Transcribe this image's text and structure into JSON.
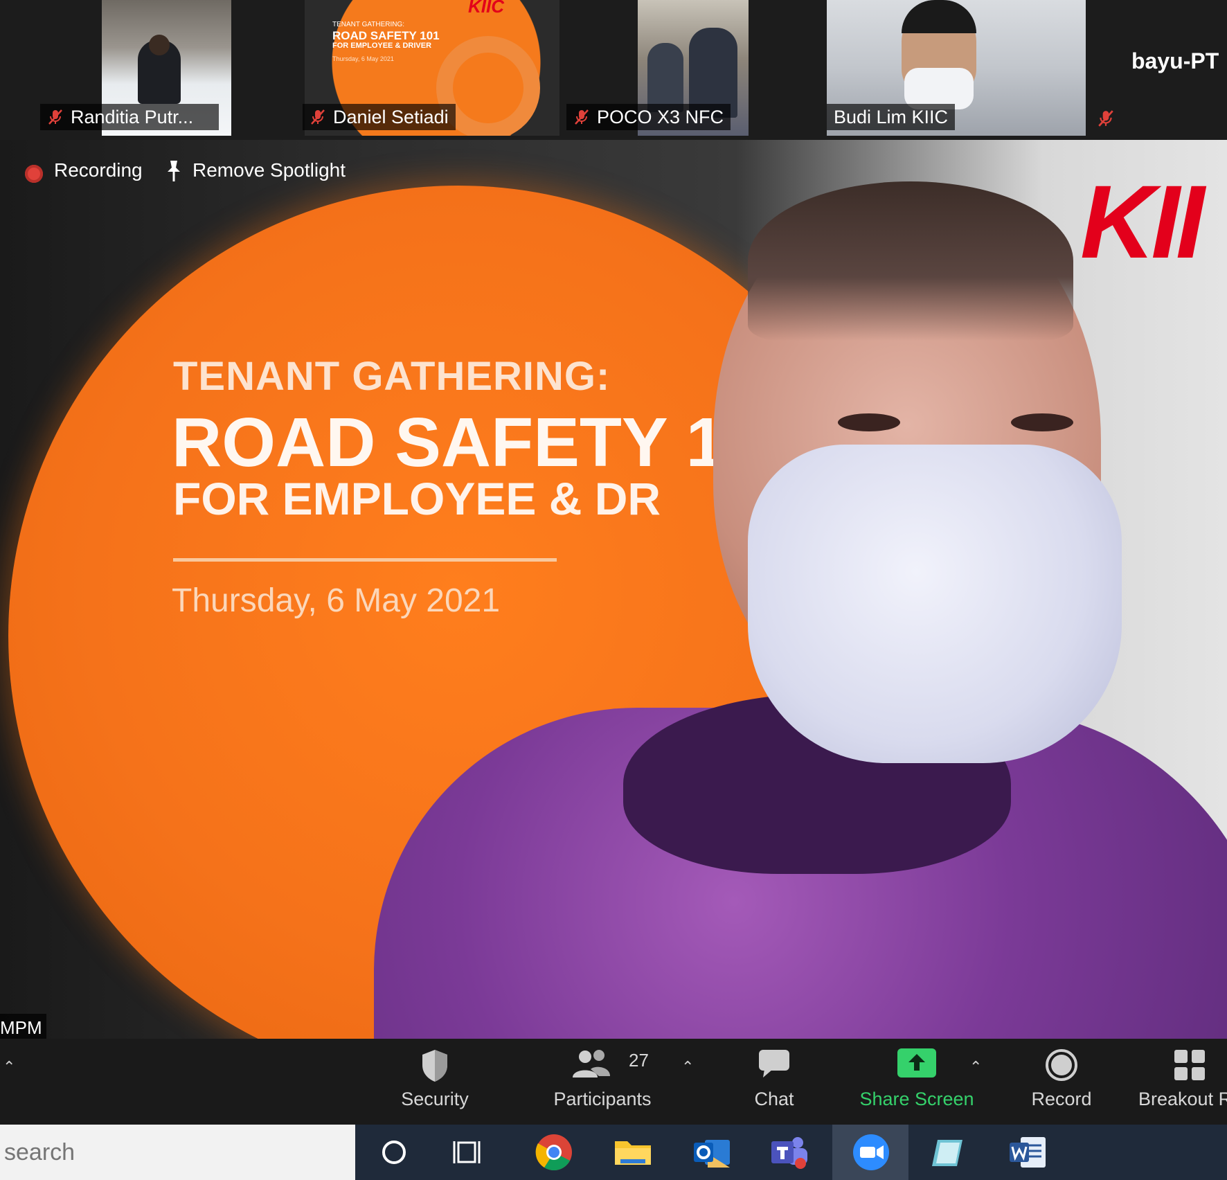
{
  "gallery": {
    "tiles": [
      {
        "name": "Randitia Putr...",
        "muted": true
      },
      {
        "name": "Daniel Setiadi",
        "muted": true
      },
      {
        "name": "POCO X3 NFC",
        "muted": true
      },
      {
        "name": "Budi Lim KIIC",
        "muted": false
      }
    ],
    "overflow_name": "bayu-PT",
    "mini_slide": {
      "logo": "KIIC",
      "line1": "TENANT GATHERING:",
      "line2": "ROAD SAFETY 101",
      "line3": "FOR EMPLOYEE & DRIVER",
      "line4": "Thursday, 6 May 2021"
    }
  },
  "meeting": {
    "recording_label": "Recording",
    "remove_spotlight_label": "Remove Spotlight",
    "speaker_name_fragment": "MPM"
  },
  "slide": {
    "line1": "TENANT GATHERING:",
    "line2": "ROAD SAFETY 1",
    "line3": "FOR EMPLOYEE & DR",
    "date": "Thursday, 6 May 2021",
    "logo": "KII"
  },
  "toolbar": {
    "security_label": "Security",
    "participants_label": "Participants",
    "participants_count": "27",
    "chat_label": "Chat",
    "share_screen_label": "Share Screen",
    "record_label": "Record",
    "breakout_label": "Breakout R"
  },
  "taskbar": {
    "search_placeholder": "search"
  },
  "colors": {
    "accent_green": "#35d16b",
    "slide_orange": "#f5721a",
    "logo_red": "#e3001b",
    "mute_red": "#e0413a"
  }
}
